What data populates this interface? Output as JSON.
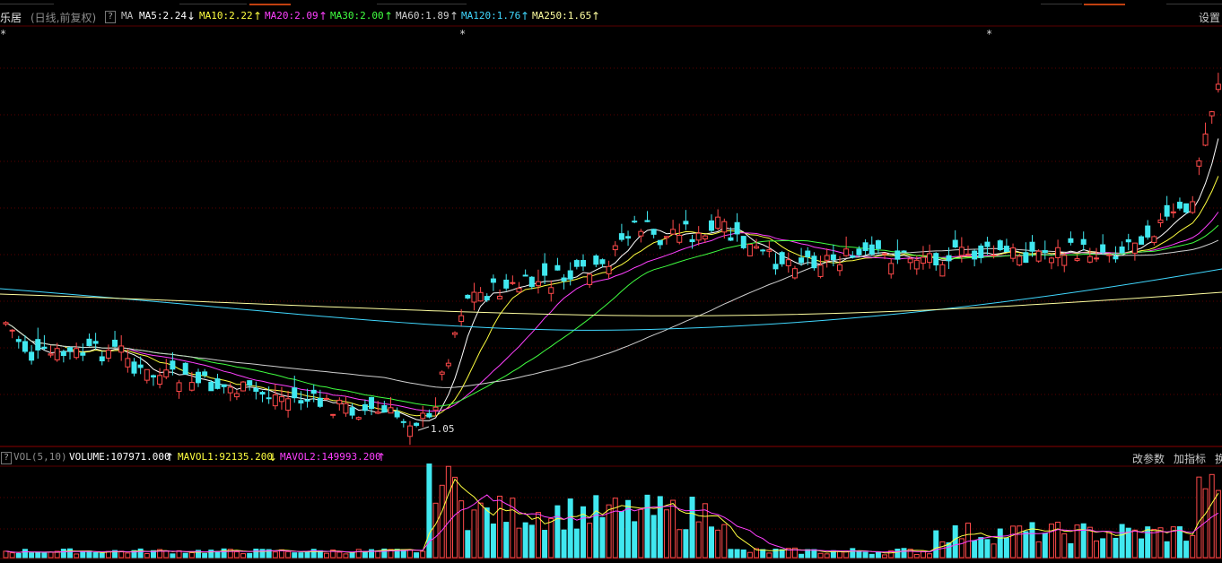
{
  "header": {
    "title": "乐居",
    "subtitle": "(日线,前复权)",
    "help": "?",
    "indicator": "MA",
    "ma": [
      {
        "label": "MA5:2.24",
        "arrow": "↓",
        "color": "#ffffff"
      },
      {
        "label": "MA10:2.22",
        "arrow": "↑",
        "color": "#ffff40"
      },
      {
        "label": "MA20:2.09",
        "arrow": "↑",
        "color": "#ff40ff"
      },
      {
        "label": "MA30:2.00",
        "arrow": "↑",
        "color": "#40ff40"
      },
      {
        "label": "MA60:1.89",
        "arrow": "↑",
        "color": "#d0d0d0"
      },
      {
        "label": "MA120:1.76",
        "arrow": "↑",
        "color": "#40d8ff"
      },
      {
        "label": "MA250:1.65",
        "arrow": "↑",
        "color": "#ffffa0"
      }
    ],
    "settings": "设置"
  },
  "price_panel": {
    "low_marker": "1.05",
    "star": "*"
  },
  "volume_header": {
    "help": "?",
    "name": "VOL(5,10)",
    "volume": "VOLUME:107971.000",
    "volume_arrow": "↑",
    "mavol1": "MAVOL1:92135.200",
    "mavol1_arrow": "↓",
    "mavol2": "MAVOL2:149993.200",
    "mavol2_arrow": "↑",
    "btn_params": "改参数",
    "btn_add": "加指标",
    "btn_switch": "换"
  },
  "colors": {
    "up": "#ff4a4a",
    "up_fill": "#000000",
    "down": "#40e8f0",
    "grid": "#5a0000",
    "ma5": "#ffffff",
    "ma10": "#ffff40",
    "ma20": "#ff40ff",
    "ma30": "#40ff40",
    "ma60": "#d0d0d0",
    "ma120": "#40d8ff",
    "ma250": "#ffffa0"
  },
  "chart_data": {
    "type": "candlestick",
    "price_range": [
      0.9,
      3.9
    ],
    "price_low_label": 1.05,
    "candles_count": 180,
    "note_volume": "volume bars with MAVOL1/MAVOL2 overlays"
  }
}
